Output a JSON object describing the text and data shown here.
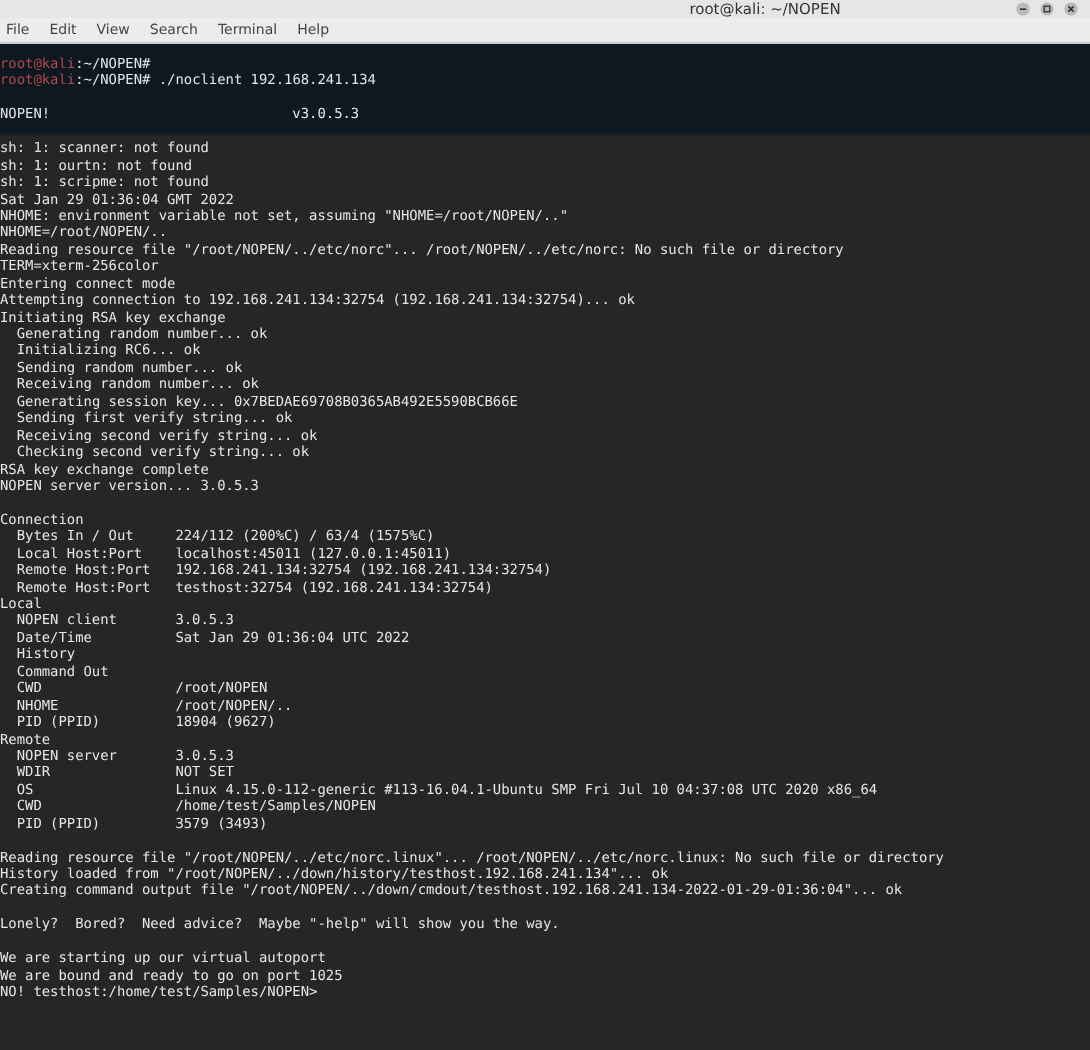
{
  "window": {
    "title": "root@kali: ~/NOPEN"
  },
  "menu": [
    "File",
    "Edit",
    "View",
    "Search",
    "Terminal",
    "Help"
  ],
  "lines": [
    {
      "kind": "prompt",
      "user": "root@kali",
      "path": ":~/NOPEN#"
    },
    {
      "kind": "prompt",
      "user": "root@kali",
      "path": ":~/NOPEN#",
      "command": " ./noclient 192.168.241.134"
    },
    {
      "kind": "blank"
    },
    {
      "kind": "text",
      "text": "NOPEN!                             v3.0.5.3"
    },
    {
      "kind": "blank"
    },
    {
      "kind": "text",
      "text": "sh: 1: scanner: not found"
    },
    {
      "kind": "text",
      "text": "sh: 1: ourtn: not found"
    },
    {
      "kind": "text",
      "text": "sh: 1: scripme: not found"
    },
    {
      "kind": "text",
      "text": "Sat Jan 29 01:36:04 GMT 2022"
    },
    {
      "kind": "text",
      "text": "NHOME: environment variable not set, assuming \"NHOME=/root/NOPEN/..\""
    },
    {
      "kind": "text",
      "text": "NHOME=/root/NOPEN/.."
    },
    {
      "kind": "text",
      "text": "Reading resource file \"/root/NOPEN/../etc/norc\"... /root/NOPEN/../etc/norc: No such file or directory"
    },
    {
      "kind": "text",
      "text": "TERM=xterm-256color"
    },
    {
      "kind": "text",
      "text": "Entering connect mode"
    },
    {
      "kind": "text",
      "text": "Attempting connection to 192.168.241.134:32754 (192.168.241.134:32754)... ok"
    },
    {
      "kind": "text",
      "text": "Initiating RSA key exchange"
    },
    {
      "kind": "text",
      "text": "  Generating random number... ok"
    },
    {
      "kind": "text",
      "text": "  Initializing RC6... ok"
    },
    {
      "kind": "text",
      "text": "  Sending random number... ok"
    },
    {
      "kind": "text",
      "text": "  Receiving random number... ok"
    },
    {
      "kind": "text",
      "text": "  Generating session key... 0x7BEDAE69708B0365AB492E5590BCB66E"
    },
    {
      "kind": "text",
      "text": "  Sending first verify string... ok"
    },
    {
      "kind": "text",
      "text": "  Receiving second verify string... ok"
    },
    {
      "kind": "text",
      "text": "  Checking second verify string... ok"
    },
    {
      "kind": "text",
      "text": "RSA key exchange complete"
    },
    {
      "kind": "text",
      "text": "NOPEN server version... 3.0.5.3"
    },
    {
      "kind": "blank"
    },
    {
      "kind": "text",
      "text": "Connection"
    },
    {
      "kind": "field",
      "label": "Bytes In / Out",
      "value": "224/112 (200%C) / 63/4 (1575%C)"
    },
    {
      "kind": "field",
      "label": "Local Host:Port",
      "value": "localhost:45011 (127.0.0.1:45011)"
    },
    {
      "kind": "field",
      "label": "Remote Host:Port",
      "value": "192.168.241.134:32754 (192.168.241.134:32754)"
    },
    {
      "kind": "field",
      "label": "Remote Host:Port",
      "value": "testhost:32754 (192.168.241.134:32754)"
    },
    {
      "kind": "text",
      "text": "Local"
    },
    {
      "kind": "field",
      "label": "NOPEN client",
      "value": "3.0.5.3"
    },
    {
      "kind": "field",
      "label": "Date/Time",
      "value": "Sat Jan 29 01:36:04 UTC 2022"
    },
    {
      "kind": "field",
      "label": "History"
    },
    {
      "kind": "field",
      "label": "Command Out"
    },
    {
      "kind": "field",
      "label": "CWD",
      "value": "/root/NOPEN"
    },
    {
      "kind": "field",
      "label": "NHOME",
      "value": "/root/NOPEN/.."
    },
    {
      "kind": "field",
      "label": "PID (PPID)",
      "value": "18904 (9627)"
    },
    {
      "kind": "text",
      "text": "Remote"
    },
    {
      "kind": "field",
      "label": "NOPEN server",
      "value": "3.0.5.3"
    },
    {
      "kind": "field",
      "label": "WDIR",
      "value": "NOT SET"
    },
    {
      "kind": "field",
      "label": "OS",
      "value": "Linux 4.15.0-112-generic #113-16.04.1-Ubuntu SMP Fri Jul 10 04:37:08 UTC 2020 x86_64"
    },
    {
      "kind": "field",
      "label": "CWD",
      "value": "/home/test/Samples/NOPEN"
    },
    {
      "kind": "field",
      "label": "PID (PPID)",
      "value": "3579 (3493)"
    },
    {
      "kind": "blank"
    },
    {
      "kind": "text",
      "text": "Reading resource file \"/root/NOPEN/../etc/norc.linux\"... /root/NOPEN/../etc/norc.linux: No such file or directory"
    },
    {
      "kind": "text",
      "text": "History loaded from \"/root/NOPEN/../down/history/testhost.192.168.241.134\"... ok"
    },
    {
      "kind": "text",
      "text": "Creating command output file \"/root/NOPEN/../down/cmdout/testhost.192.168.241.134-2022-01-29-01:36:04\"... ok"
    },
    {
      "kind": "blank"
    },
    {
      "kind": "text",
      "text": "Lonely?  Bored?  Need advice?  Maybe \"-help\" will show you the way."
    },
    {
      "kind": "blank"
    },
    {
      "kind": "text",
      "text": "We are starting up our virtual autoport"
    },
    {
      "kind": "text",
      "text": "We are bound and ready to go on port 1025"
    },
    {
      "kind": "text",
      "text": "NO! testhost:/home/test/Samples/NOPEN>"
    }
  ]
}
